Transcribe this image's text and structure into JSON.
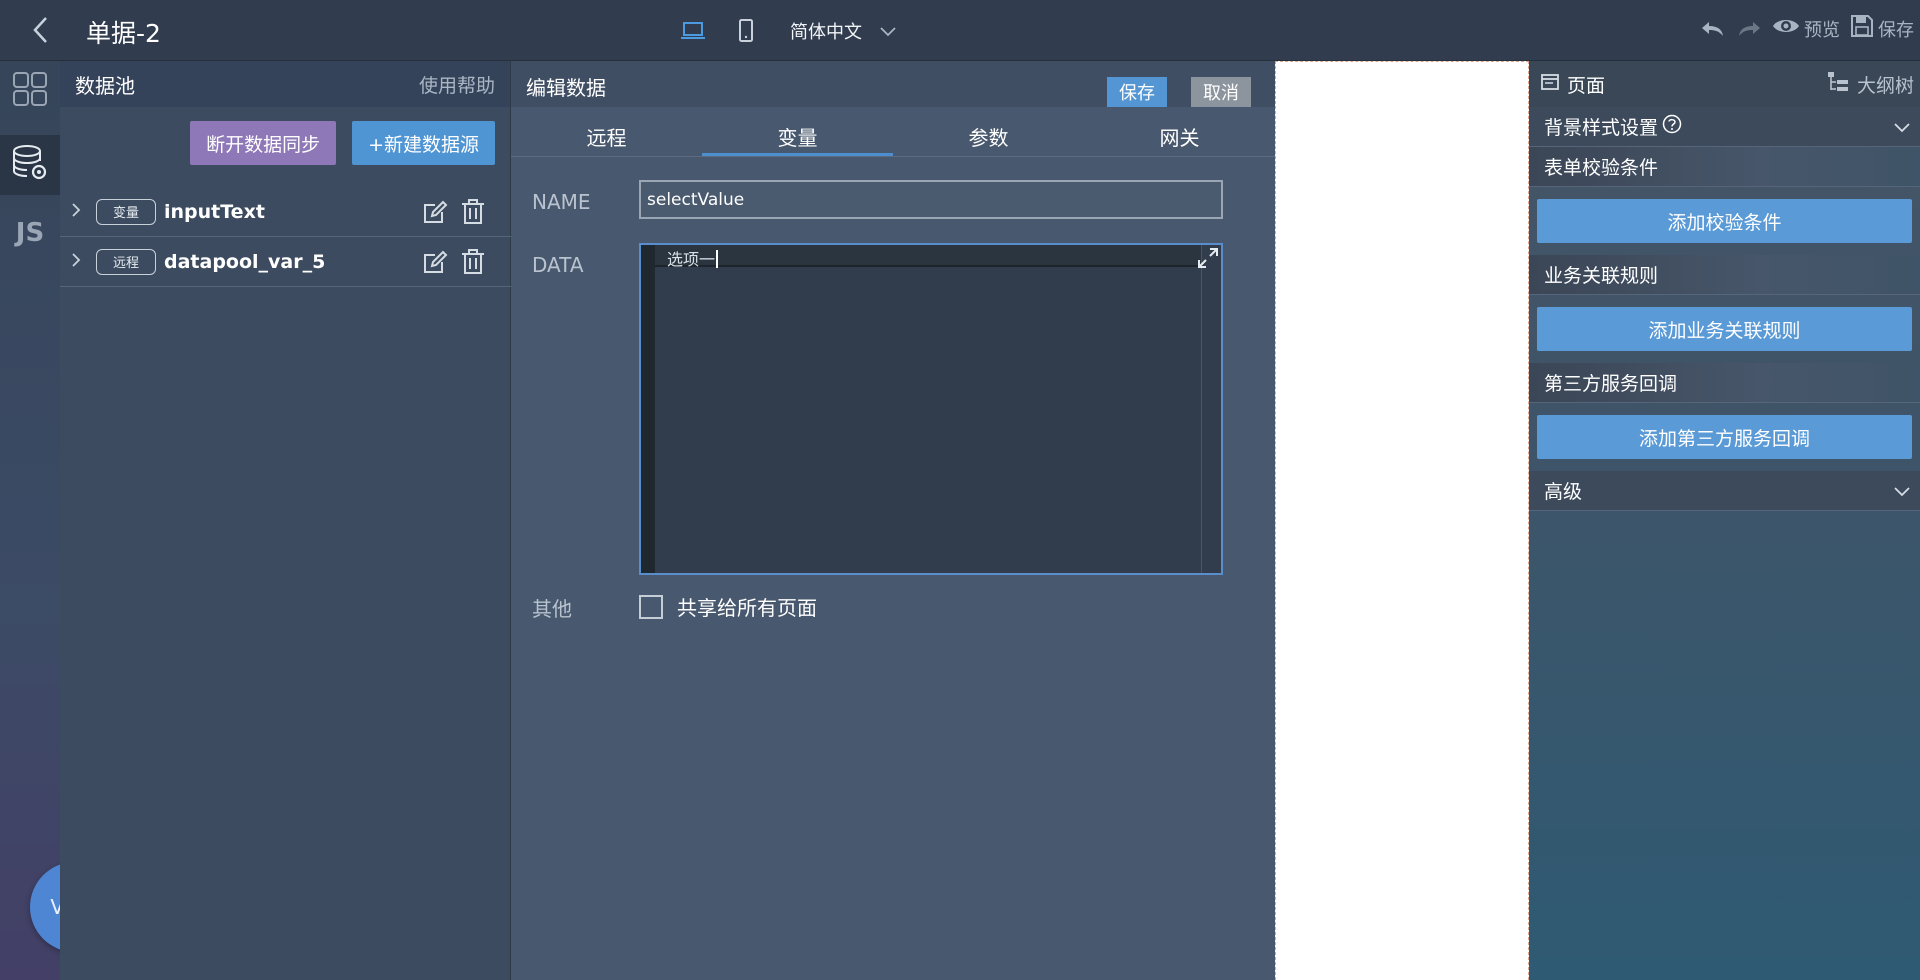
{
  "topbar": {
    "title": "单据-2",
    "language": "简体中文",
    "preview_label": "预览",
    "save_label": "保存"
  },
  "rail": {
    "badge": "Vone",
    "js_label": "JS"
  },
  "pool": {
    "title": "数据池",
    "help": "使用帮助",
    "disconnect_label": "断开数据同步",
    "new_source_label": "+新建数据源",
    "items": [
      {
        "tag": "变量",
        "name": "inputText"
      },
      {
        "tag": "远程",
        "name": "datapool_var_5"
      }
    ]
  },
  "edit": {
    "title": "编辑数据",
    "save_label": "保存",
    "cancel_label": "取消",
    "tabs": [
      "远程",
      "变量",
      "参数",
      "网关"
    ],
    "active_tab": "变量",
    "name_label": "NAME",
    "name_value": "selectValue",
    "data_label": "DATA",
    "data_value": "选项一",
    "other_label": "其他",
    "share_label": "共享给所有页面"
  },
  "props": {
    "page_label": "页面",
    "outline_label": "大纲树",
    "bg_style": "背景样式设置",
    "validation_title": "表单校验条件",
    "add_validation": "添加校验条件",
    "business_title": "业务关联规则",
    "add_business": "添加业务关联规则",
    "callback_title": "第三方服务回调",
    "add_callback": "添加第三方服务回调",
    "advanced": "高级"
  },
  "colors": {
    "accent": "#4f95d4",
    "purple": "#8e78b8",
    "topbar_bg": "#313d4f"
  }
}
